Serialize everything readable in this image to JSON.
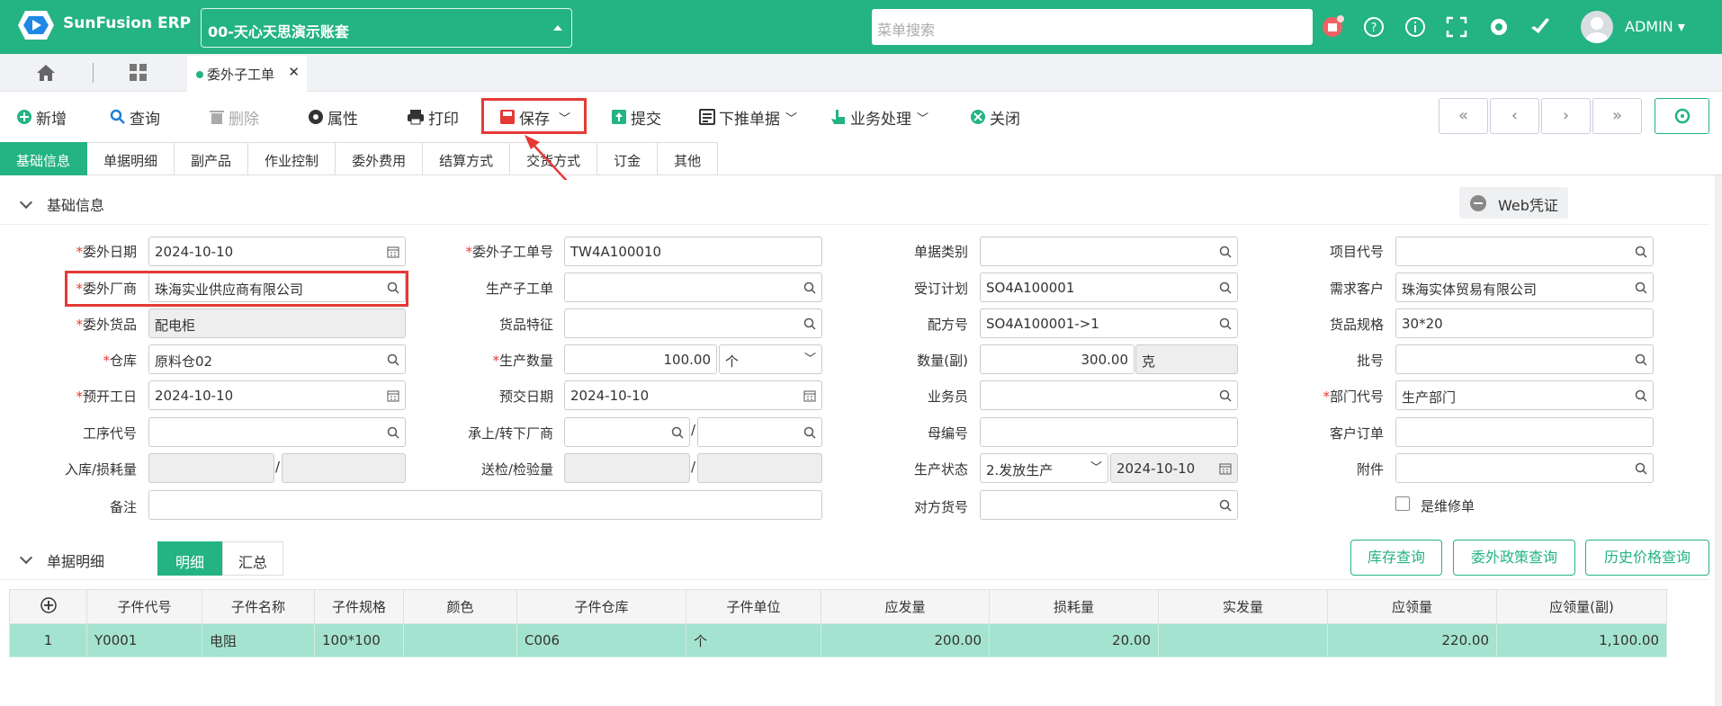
{
  "brand": "SunFusion ERP",
  "account": "00-天心天思演示账套",
  "search_placeholder": "菜单搜索",
  "user": "ADMIN",
  "active_tab": "委外子工单",
  "toolbar": {
    "new": "新增",
    "query": "查询",
    "delete": "删除",
    "props": "属性",
    "print": "打印",
    "save": "保存",
    "submit": "提交",
    "push": "下推单据",
    "biz": "业务处理",
    "close": "关闭"
  },
  "form_tabs": [
    "基础信息",
    "单据明细",
    "副产品",
    "作业控制",
    "委外费用",
    "结算方式",
    "交货方式",
    "订金",
    "其他"
  ],
  "section_title": "基础信息",
  "web_voucher": "Web凭证",
  "fields": {
    "outsource_date": {
      "label": "委外日期",
      "value": "2024-10-10"
    },
    "vendor": {
      "label": "委外厂商",
      "value": "珠海实业供应商有限公司"
    },
    "goods": {
      "label": "委外货品",
      "value": "配电柜"
    },
    "warehouse": {
      "label": "仓库",
      "value": "原料仓02"
    },
    "plan_start": {
      "label": "预开工日",
      "value": "2024-10-10"
    },
    "process_code": {
      "label": "工序代号",
      "value": ""
    },
    "in_loss": {
      "label": "入库/损耗量",
      "value": ""
    },
    "remark": {
      "label": "备注",
      "value": ""
    },
    "sub_order_no": {
      "label": "委外子工单号",
      "value": "TW4A100010"
    },
    "prod_sub_order": {
      "label": "生产子工单",
      "value": ""
    },
    "goods_feature": {
      "label": "货品特征",
      "value": ""
    },
    "prod_qty": {
      "label": "生产数量",
      "value": "100.00",
      "unit": "个"
    },
    "plan_delivery": {
      "label": "预交日期",
      "value": "2024-10-10"
    },
    "transfer_vendor": {
      "label": "承上/转下厂商",
      "value": ""
    },
    "inspect_qty": {
      "label": "送检/检验量",
      "value": ""
    },
    "doc_type": {
      "label": "单据类别",
      "value": ""
    },
    "order_plan": {
      "label": "受订计划",
      "value": "SO4A100001"
    },
    "formula_no": {
      "label": "配方号",
      "value": "SO4A100001->1"
    },
    "qty_sub": {
      "label": "数量(副)",
      "value": "300.00",
      "unit": "克"
    },
    "salesman": {
      "label": "业务员",
      "value": ""
    },
    "parent_no": {
      "label": "母编号",
      "value": ""
    },
    "prod_status": {
      "label": "生产状态",
      "value": "2.发放生产",
      "date": "2024-10-10"
    },
    "counter_goods": {
      "label": "对方货号",
      "value": ""
    },
    "project_code": {
      "label": "项目代号",
      "value": ""
    },
    "demand_customer": {
      "label": "需求客户",
      "value": "珠海实体贸易有限公司"
    },
    "goods_spec": {
      "label": "货品规格",
      "value": "30*20"
    },
    "batch_no": {
      "label": "批号",
      "value": ""
    },
    "dept_code": {
      "label": "部门代号",
      "value": "生产部门"
    },
    "customer_order": {
      "label": "客户订单",
      "value": ""
    },
    "attachment": {
      "label": "附件",
      "value": ""
    },
    "is_repair": {
      "label": "是维修单",
      "value": false
    }
  },
  "detail_section": {
    "title": "单据明细",
    "seg_detail": "明细",
    "seg_summary": "汇总",
    "btn_stock": "库存查询",
    "btn_policy": "委外政策查询",
    "btn_history": "历史价格查询"
  },
  "table": {
    "headers": [
      "子件代号",
      "子件名称",
      "子件规格",
      "颜色",
      "子件仓库",
      "子件单位",
      "应发量",
      "损耗量",
      "实发量",
      "应领量",
      "应领量(副)"
    ],
    "rows": [
      [
        "1",
        "Y0001",
        "电阻",
        "100*100",
        "",
        "C006",
        "个",
        "200.00",
        "20.00",
        "",
        "220.00",
        "1,100.00"
      ]
    ]
  },
  "colors": {
    "primary": "#24b383",
    "highlight": "#e53935",
    "row": "#a4e3cf"
  }
}
